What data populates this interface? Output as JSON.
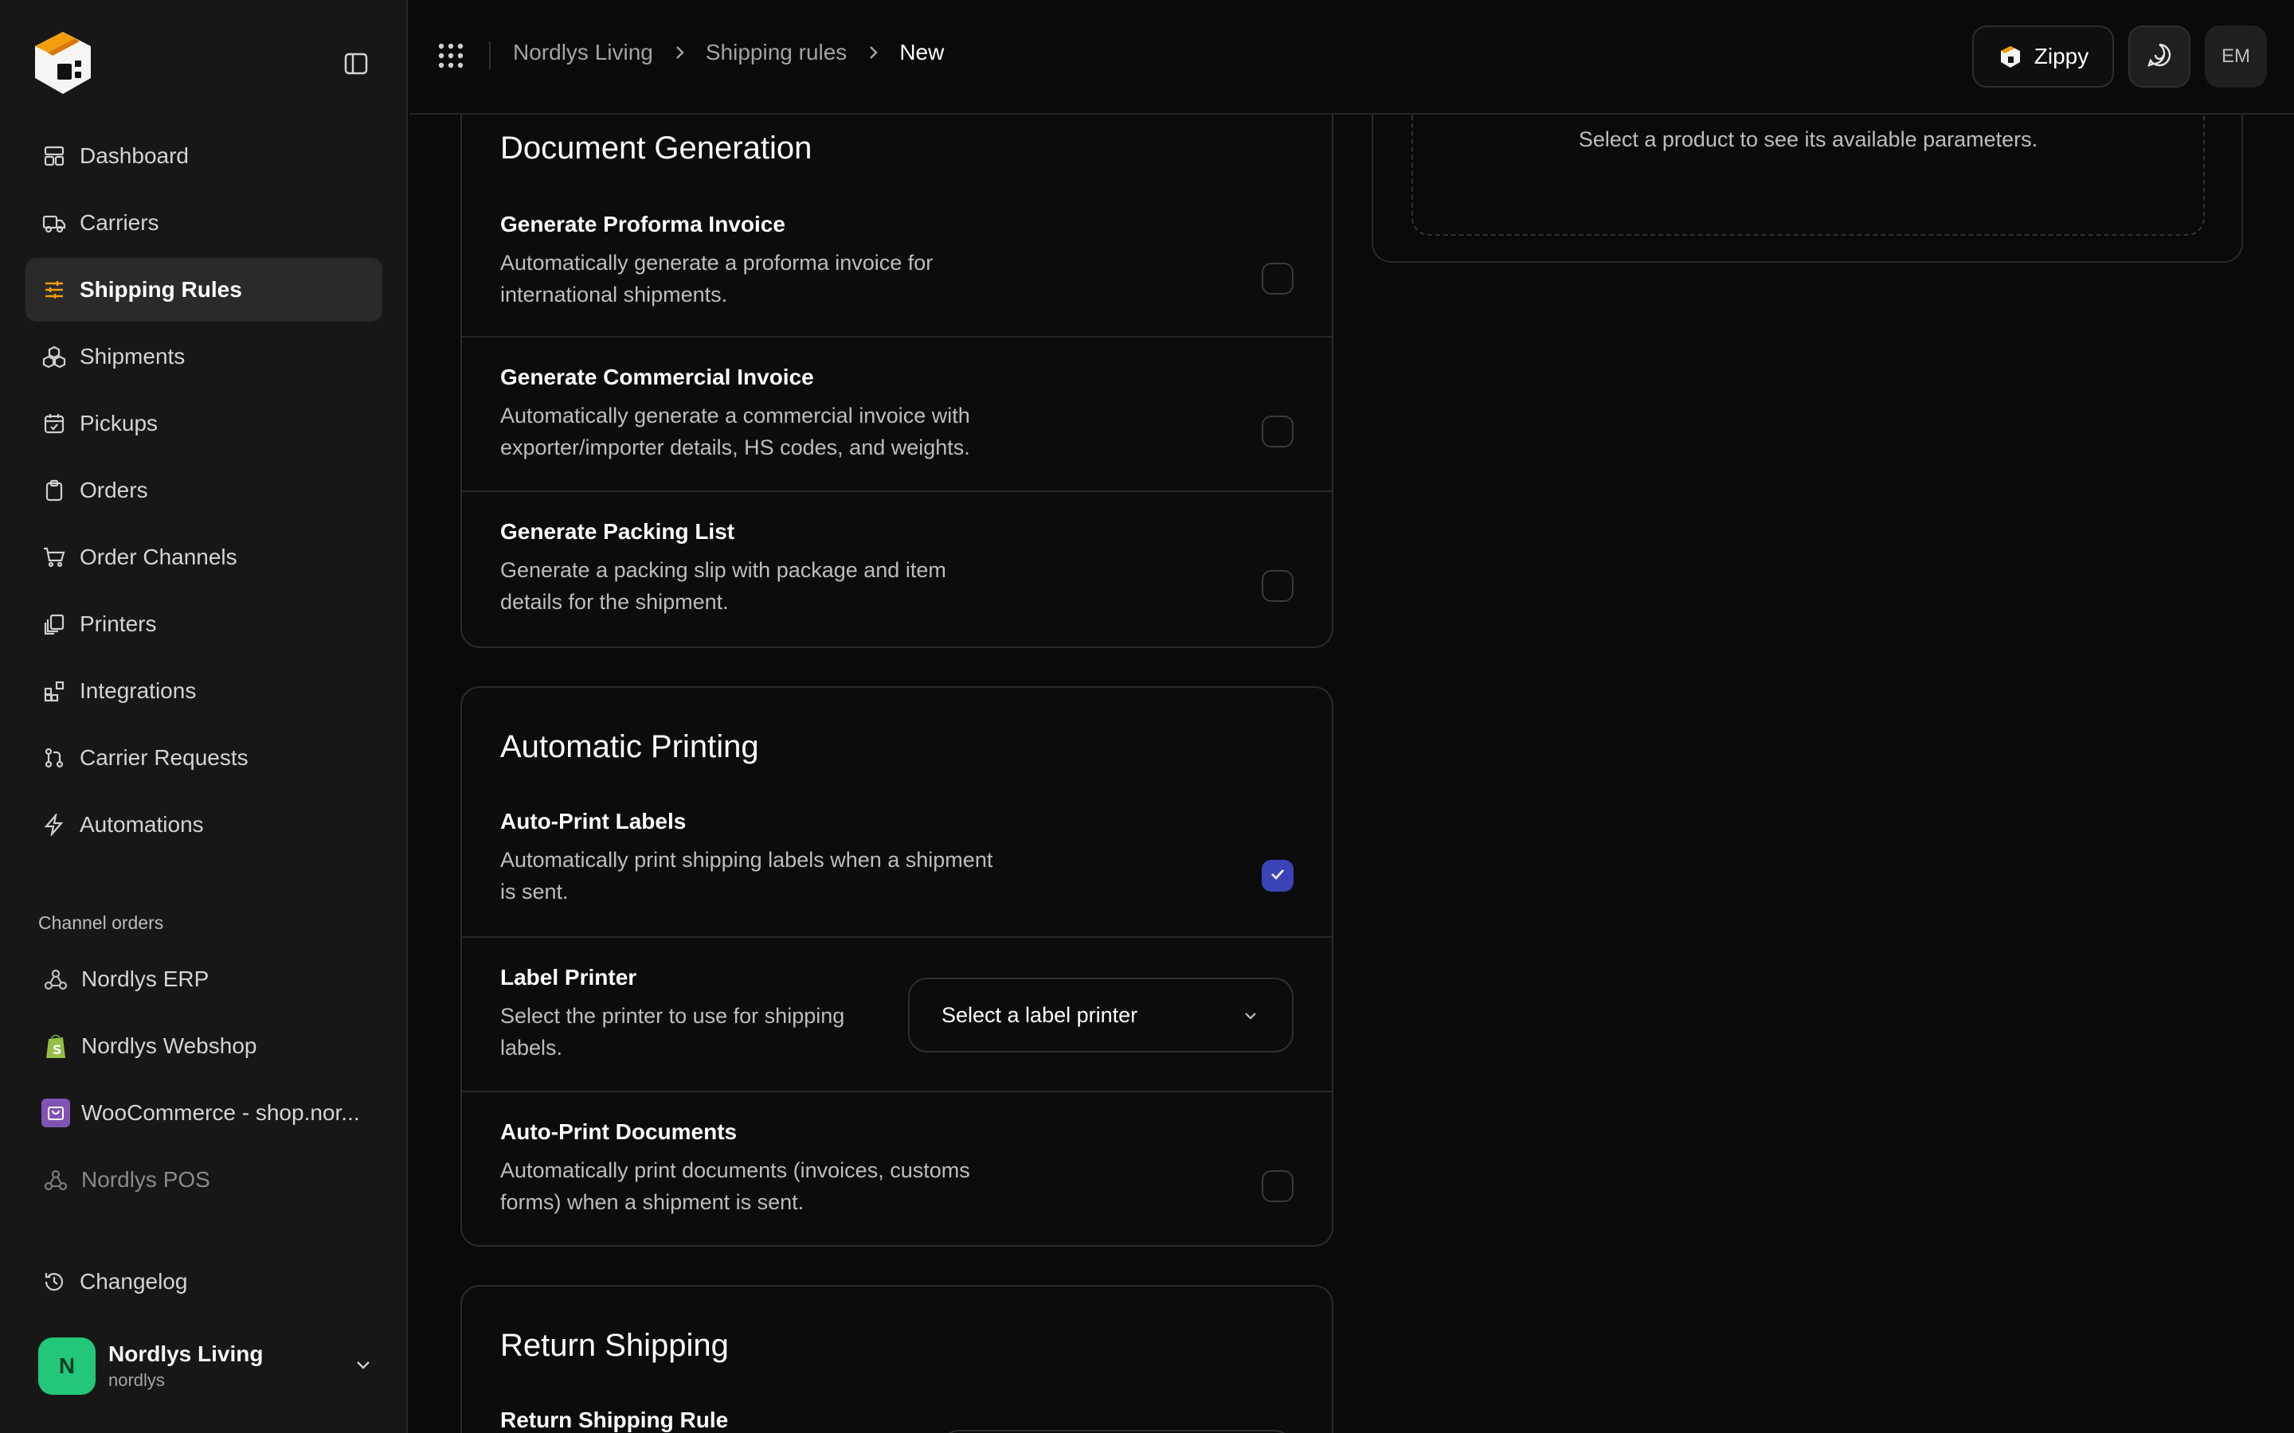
{
  "brand": {
    "accent": "#f59e0b",
    "checkbox_checked": "#3b43b8",
    "account_avatar": "#22c77a"
  },
  "sidebar": {
    "items": [
      {
        "label": "Dashboard",
        "icon": "layout-dashboard-icon"
      },
      {
        "label": "Carriers",
        "icon": "truck-icon"
      },
      {
        "label": "Shipping Rules",
        "icon": "sliders-icon",
        "active": true
      },
      {
        "label": "Shipments",
        "icon": "boxes-icon"
      },
      {
        "label": "Pickups",
        "icon": "calendar-check-icon"
      },
      {
        "label": "Orders",
        "icon": "clipboard-icon"
      },
      {
        "label": "Order Channels",
        "icon": "cart-icon"
      },
      {
        "label": "Printers",
        "icon": "copies-icon"
      },
      {
        "label": "Integrations",
        "icon": "blocks-icon"
      },
      {
        "label": "Carrier Requests",
        "icon": "git-pull-request-icon"
      },
      {
        "label": "Automations",
        "icon": "lightning-icon"
      }
    ],
    "channels_label": "Channel orders",
    "channels": [
      {
        "label": "Nordlys ERP",
        "icon": "webhook-icon"
      },
      {
        "label": "Nordlys Webshop",
        "icon": "shopify-icon"
      },
      {
        "label": "WooCommerce - shop.nor...",
        "icon": "woocommerce-icon"
      },
      {
        "label": "Nordlys POS",
        "icon": "webhook-icon",
        "muted": true
      }
    ],
    "changelog": "Changelog",
    "account": {
      "initial": "N",
      "name": "Nordlys Living",
      "handle": "nordlys"
    }
  },
  "header": {
    "breadcrumb": [
      "Nordlys Living",
      "Shipping rules",
      "New"
    ],
    "zippy_label": "Zippy",
    "user_initials": "EM"
  },
  "parameters": {
    "empty_text": "Select a product to see its available parameters."
  },
  "document_generation": {
    "title": "Document Generation",
    "rows": [
      {
        "title": "Generate Proforma Invoice",
        "desc": "Automatically generate a proforma invoice for international shipments.",
        "checked": false
      },
      {
        "title": "Generate Commercial Invoice",
        "desc": "Automatically generate a commercial invoice with exporter/importer details, HS codes, and weights.",
        "checked": false
      },
      {
        "title": "Generate Packing List",
        "desc": "Generate a packing slip with package and item details for the shipment.",
        "checked": false
      }
    ]
  },
  "automatic_printing": {
    "title": "Automatic Printing",
    "auto_print_labels": {
      "title": "Auto-Print Labels",
      "desc": "Automatically print shipping labels when a shipment is sent.",
      "checked": true
    },
    "label_printer": {
      "title": "Label Printer",
      "desc": "Select the printer to use for shipping labels.",
      "placeholder": "Select a label printer"
    },
    "auto_print_documents": {
      "title": "Auto-Print Documents",
      "desc": "Automatically print documents (invoices, customs forms) when a shipment is sent.",
      "checked": false
    }
  },
  "return_shipping": {
    "title": "Return Shipping",
    "rule_title": "Return Shipping Rule"
  }
}
